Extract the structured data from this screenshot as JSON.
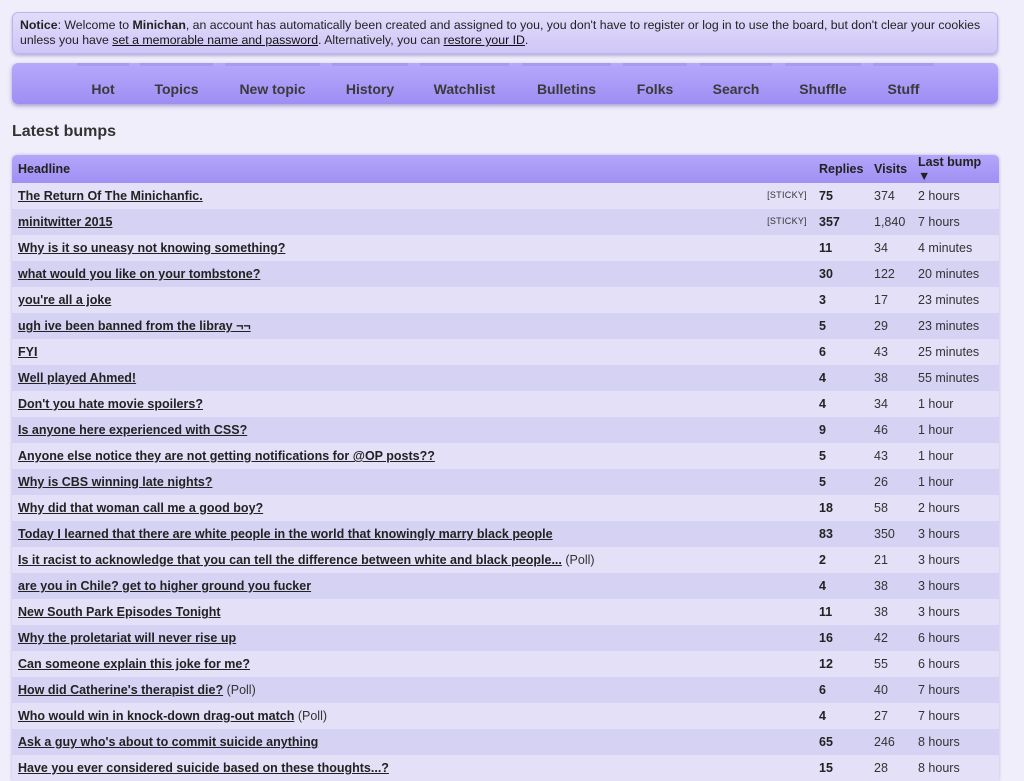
{
  "notice": {
    "label": "Notice",
    "p1": ": Welcome to ",
    "site": "Minichan",
    "p2": ", an account has automatically been created and assigned to you, you don't have to register or log in to use the board, but don't clear your cookies unless you have ",
    "link1": "set a memorable name and password",
    "p3": ". Alternatively, you can ",
    "link2": "restore your ID",
    "p4": "."
  },
  "nav": [
    "Hot",
    "Topics",
    "New topic",
    "History",
    "Watchlist",
    "Bulletins",
    "Folks",
    "Search",
    "Shuffle",
    "Stuff"
  ],
  "heading": "Latest bumps",
  "table": {
    "headers": {
      "headline": "Headline",
      "replies": "Replies",
      "visits": "Visits",
      "bump": "Last bump ▼"
    },
    "rows": [
      {
        "headline": "The Return Of The Minichanfic.",
        "tag": "[STICKY]",
        "replies": "75",
        "visits": "374",
        "bump": "2 hours"
      },
      {
        "headline": "minitwitter 2015",
        "tag": "[STICKY]",
        "replies": "357",
        "visits": "1,840",
        "bump": "7 hours"
      },
      {
        "headline": "Why is it so uneasy not knowing something?",
        "replies": "11",
        "visits": "34",
        "bump": "4 minutes"
      },
      {
        "headline": "what would you like on your tombstone?",
        "replies": "30",
        "visits": "122",
        "bump": "20 minutes"
      },
      {
        "headline": "you're all a joke",
        "replies": "3",
        "visits": "17",
        "bump": "23 minutes"
      },
      {
        "headline": "ugh ive been banned from the libray ¬¬",
        "replies": "5",
        "visits": "29",
        "bump": "23 minutes"
      },
      {
        "headline": "FYI",
        "replies": "6",
        "visits": "43",
        "bump": "25 minutes"
      },
      {
        "headline": "Well played Ahmed!",
        "replies": "4",
        "visits": "38",
        "bump": "55 minutes"
      },
      {
        "headline": "Don't you hate movie spoilers?",
        "replies": "4",
        "visits": "34",
        "bump": "1 hour"
      },
      {
        "headline": "Is anyone here experienced with CSS?",
        "replies": "9",
        "visits": "46",
        "bump": "1 hour"
      },
      {
        "headline": "Anyone else notice they are not getting notifications for @OP posts??",
        "replies": "5",
        "visits": "43",
        "bump": "1 hour"
      },
      {
        "headline": "Why is CBS winning late nights?",
        "replies": "5",
        "visits": "26",
        "bump": "1 hour"
      },
      {
        "headline": "Why did that woman call me a good boy?",
        "replies": "18",
        "visits": "58",
        "bump": "2 hours"
      },
      {
        "headline": "Today I learned that there are white people in the world that knowingly marry black people",
        "replies": "83",
        "visits": "350",
        "bump": "3 hours"
      },
      {
        "headline": "Is it racist to acknowledge that you can tell the difference between white and black people...",
        "poll": "(Poll)",
        "replies": "2",
        "visits": "21",
        "bump": "3 hours"
      },
      {
        "headline": "are you in Chile? get to higher ground you fucker",
        "replies": "4",
        "visits": "38",
        "bump": "3 hours"
      },
      {
        "headline": "New South Park Episodes Tonight",
        "replies": "11",
        "visits": "38",
        "bump": "3 hours"
      },
      {
        "headline": "Why the proletariat will never rise up",
        "replies": "16",
        "visits": "42",
        "bump": "6 hours"
      },
      {
        "headline": "Can someone explain this joke for me?",
        "replies": "12",
        "visits": "55",
        "bump": "6 hours"
      },
      {
        "headline": "How did Catherine's therapist die?",
        "poll": "(Poll)",
        "replies": "6",
        "visits": "40",
        "bump": "7 hours"
      },
      {
        "headline": "Who would win in knock-down drag-out match",
        "poll": "(Poll)",
        "replies": "4",
        "visits": "27",
        "bump": "7 hours"
      },
      {
        "headline": "Ask a guy who's about to commit suicide anything",
        "replies": "65",
        "visits": "246",
        "bump": "8 hours"
      },
      {
        "headline": "Have you ever considered suicide based on these thoughts...?",
        "replies": "15",
        "visits": "28",
        "bump": "8 hours"
      }
    ]
  },
  "colors": {
    "nav_bg": "#a898f6",
    "row_odd": "#e3e0f8",
    "row_even": "#d6d2f4",
    "page_bg": "#f0eefb"
  }
}
